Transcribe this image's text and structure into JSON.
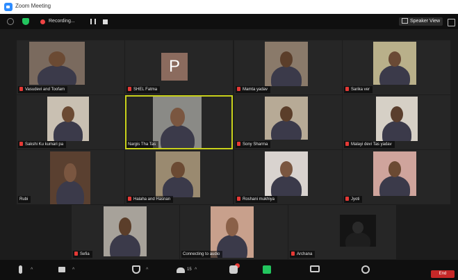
{
  "window": {
    "title": "Zoom Meeting"
  },
  "topbar": {
    "recording_label": "Recording...",
    "view_label": "Speaker View"
  },
  "participants": [
    {
      "name": "Vasudevi and Toofam",
      "muted": true,
      "bg": "#7a6a5e",
      "skin": "#6b4a33"
    },
    {
      "name": "SHEL Fatma",
      "muted": true,
      "avatar": "P",
      "bg": "#262626"
    },
    {
      "name": "Mamta yadav",
      "muted": true,
      "bg": "#8a7a6a",
      "skin": "#5b3e2a"
    },
    {
      "name": "Sarika ver",
      "muted": true,
      "bg": "#b9b08a",
      "skin": "#6a4a35"
    },
    {
      "name": "Sakshi Ku kumari pa",
      "muted": true,
      "bg": "#c9c0b2",
      "skin": "#6b4a33"
    },
    {
      "name": "Nargis Tha Tas",
      "muted": false,
      "active": true,
      "bg": "#8a8a86",
      "skin": "#7a5640"
    },
    {
      "name": "Sony Sharma",
      "muted": true,
      "bg": "#b7aa96",
      "skin": "#5b3e2a"
    },
    {
      "name": "Malayi devi Tas yadav",
      "muted": true,
      "bg": "#d6d0c6",
      "skin": "#5a3e2d"
    },
    {
      "name": "Rubi",
      "muted": false,
      "bg": "#5a4030",
      "skin": "#7a5640"
    },
    {
      "name": "Halaha and Hasnan",
      "muted": true,
      "bg": "#9a8a70",
      "skin": "#6b4a33"
    },
    {
      "name": "Roshani mukhiya",
      "muted": true,
      "bg": "#d9d3cf",
      "skin": "#7a5640"
    },
    {
      "name": "Jyoti",
      "muted": true,
      "bg": "#cfa49c",
      "skin": "#6b4a33"
    },
    {
      "name": "Sefia",
      "muted": true,
      "bg": "#a7a29a",
      "skin": "#5b3e2a"
    },
    {
      "name": "Connecting to audio",
      "muted": false,
      "bg": "#c8a08c",
      "skin": "#8a6048"
    },
    {
      "name": "Archana",
      "muted": true,
      "bg": "#141414",
      "skin": "#2a2a2a"
    }
  ],
  "toolbar": {
    "items": [
      {
        "name": "mute-button",
        "icon": "microphone-icon"
      },
      {
        "name": "video-button",
        "icon": "camera-icon"
      },
      {
        "name": "security-button",
        "icon": "shield-icon"
      },
      {
        "name": "participants-button",
        "icon": "people-icon",
        "count": "15"
      },
      {
        "name": "chat-button",
        "icon": "chat-icon"
      },
      {
        "name": "share-screen-button",
        "icon": "share-screen-icon"
      },
      {
        "name": "record-button",
        "icon": "record-icon"
      },
      {
        "name": "reactions-button",
        "icon": "reactions-icon"
      }
    ],
    "end_label": "End"
  },
  "colors": {
    "active_speaker": "#c9d21b",
    "end": "#c62828",
    "share": "#22c55e",
    "muted": "#e53935"
  }
}
